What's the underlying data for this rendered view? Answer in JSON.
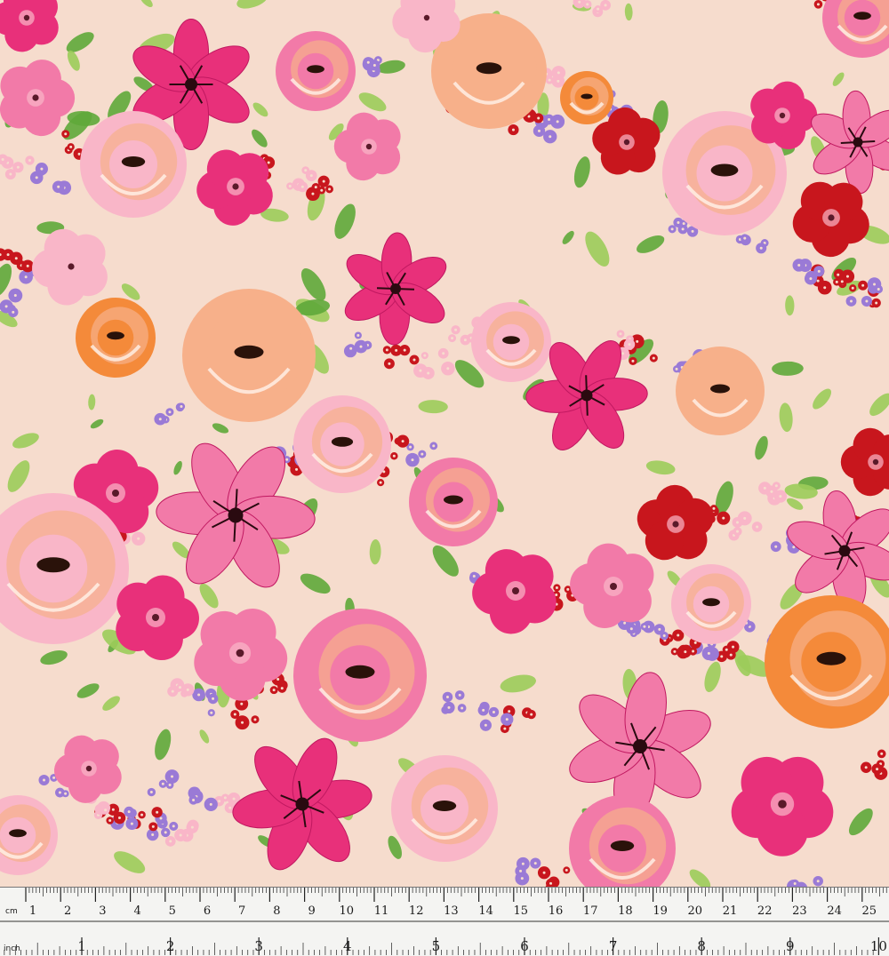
{
  "colors": {
    "background": "#f6dccd",
    "hot_pink": "#e8307a",
    "pink": "#f27aa8",
    "light_pink": "#f9b6c8",
    "orange": "#f48a3a",
    "peach": "#f7b08a",
    "red": "#c8161d",
    "purple": "#9a7ad6",
    "green": "#5fa83a",
    "light_green": "#9ccc5a"
  },
  "ruler": {
    "cm_unit": "cm",
    "inch_unit": "inch",
    "cm_labels": [
      "1",
      "2",
      "3",
      "4",
      "5",
      "6",
      "7",
      "8",
      "9",
      "10",
      "11",
      "12",
      "13",
      "14",
      "15",
      "16",
      "17",
      "18",
      "19",
      "20",
      "21",
      "22",
      "23",
      "24",
      "25"
    ],
    "inch_labels": [
      "1",
      "2",
      "3",
      "4",
      "5",
      "6",
      "7",
      "8",
      "9",
      "10"
    ]
  }
}
